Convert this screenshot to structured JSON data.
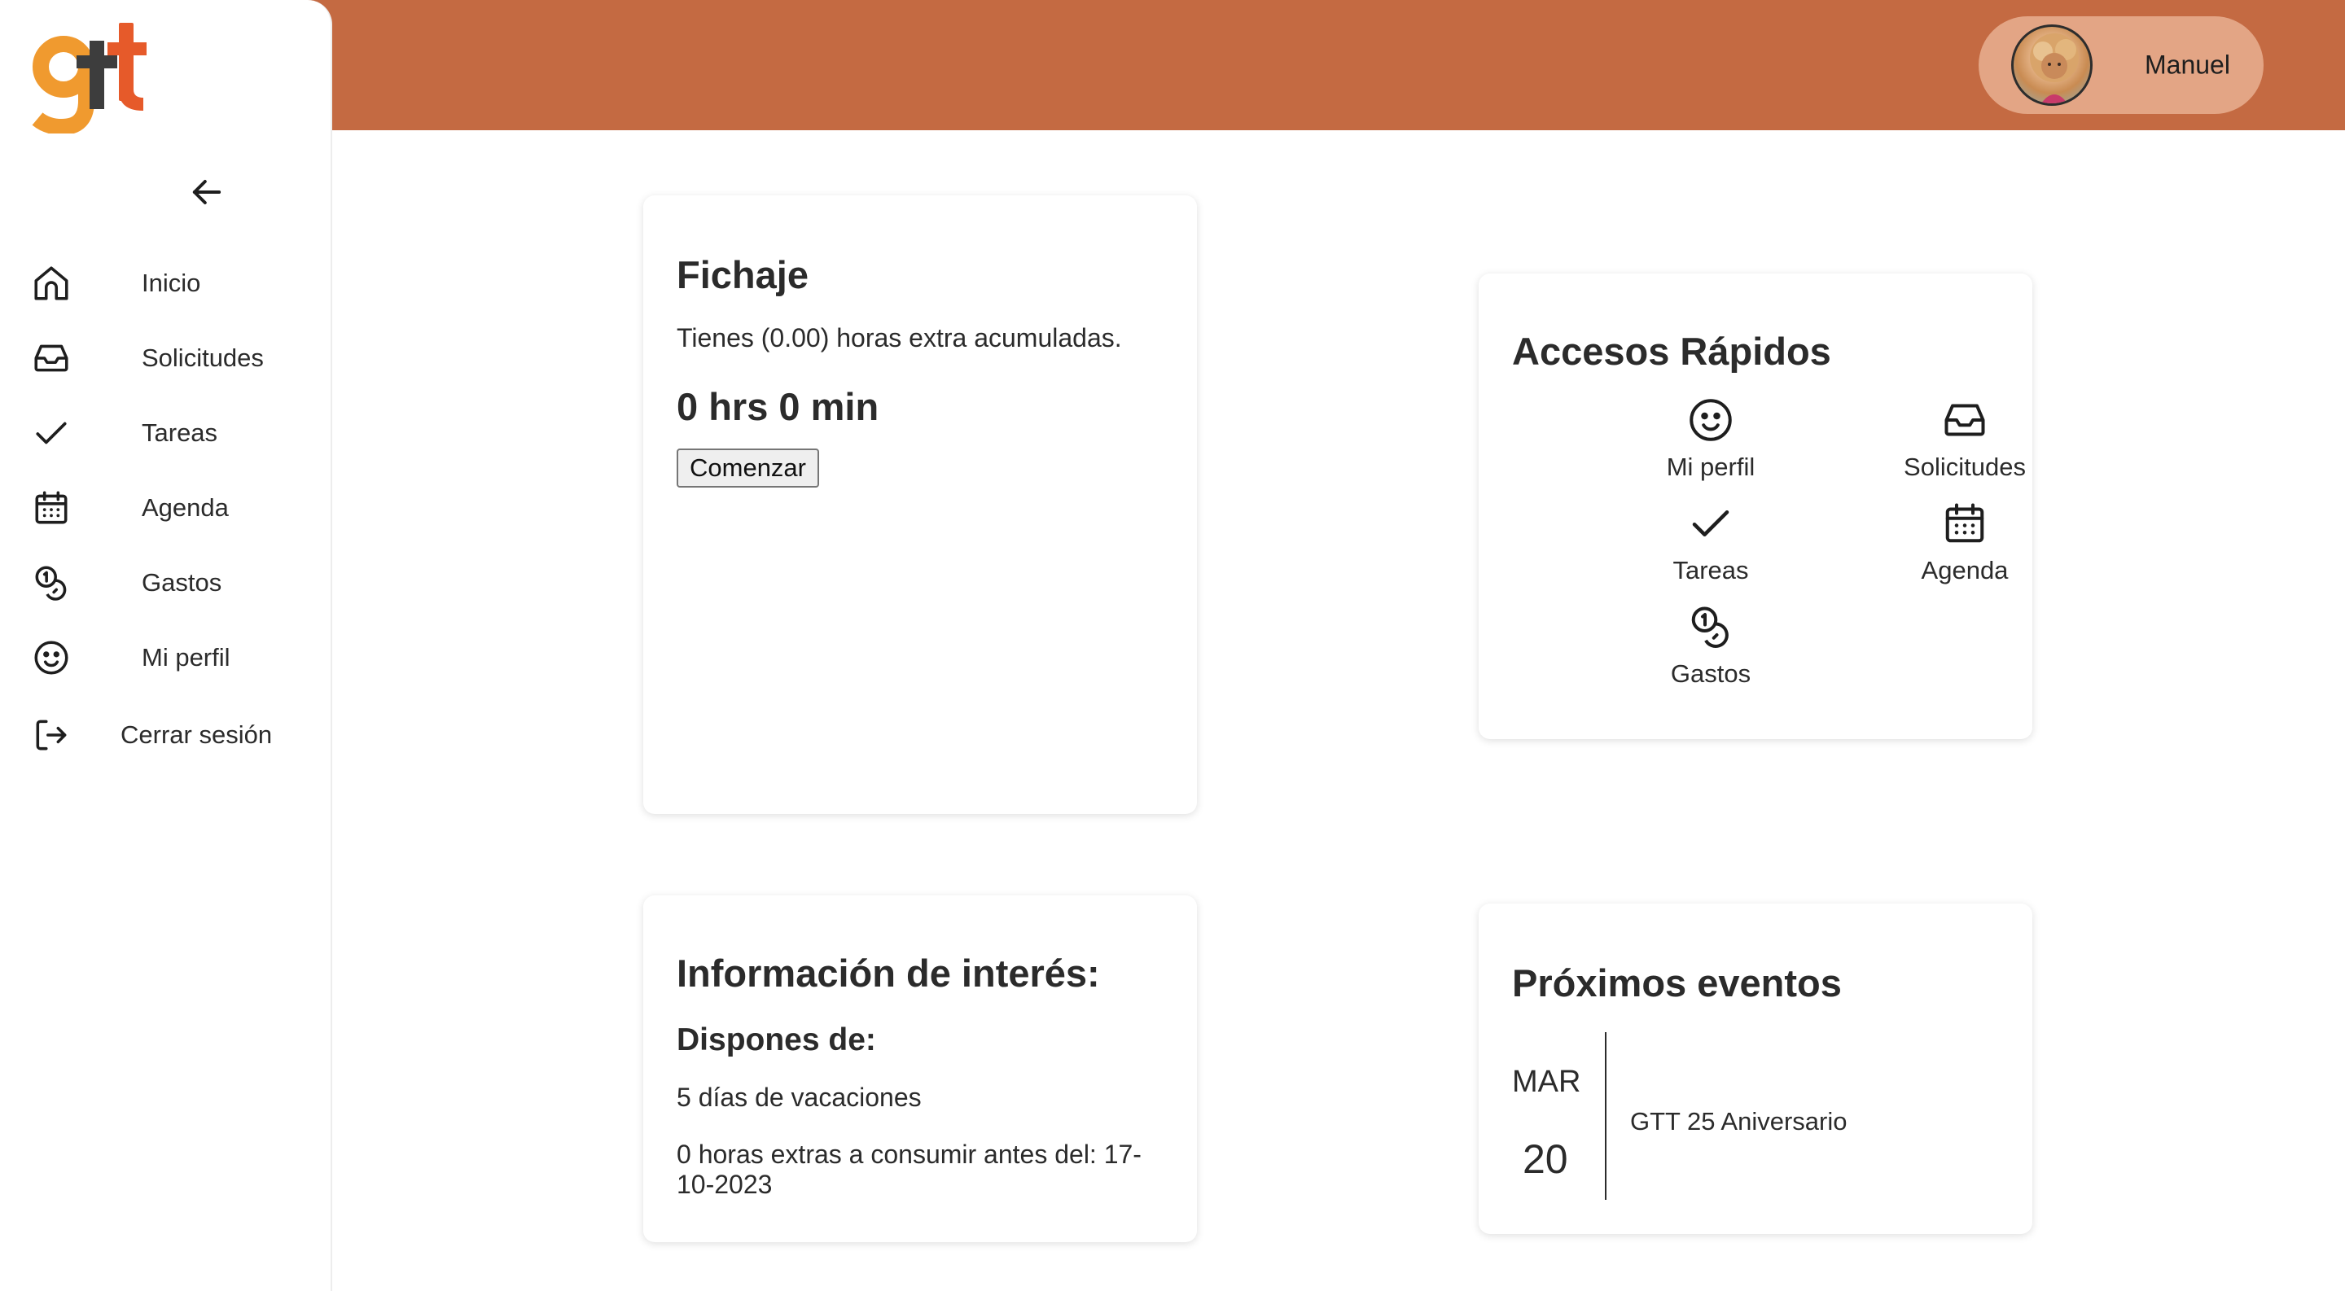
{
  "brand": {
    "logo_text": "gtt",
    "accent": "#c46a42",
    "pill": "#e3a585"
  },
  "header": {
    "user_name": "Manuel",
    "avatar_icon": "user-avatar"
  },
  "sidebar": {
    "collapse_icon": "arrow-left-icon",
    "items": [
      {
        "label": "Inicio",
        "icon": "home-icon"
      },
      {
        "label": "Solicitudes",
        "icon": "inbox-icon"
      },
      {
        "label": "Tareas",
        "icon": "check-icon"
      },
      {
        "label": "Agenda",
        "icon": "calendar-icon"
      },
      {
        "label": "Gastos",
        "icon": "coins-icon"
      },
      {
        "label": "Mi perfil",
        "icon": "smiley-icon"
      },
      {
        "label": "Cerrar sesión",
        "icon": "logout-icon"
      }
    ]
  },
  "fichaje": {
    "title": "Fichaje",
    "description": "Tienes (0.00) horas extra acumuladas.",
    "timer": "0 hrs 0 min",
    "start_label": "Comenzar"
  },
  "accesos": {
    "title": "Accesos Rápidos",
    "items": [
      {
        "label": "Mi perfil",
        "icon": "smiley-icon"
      },
      {
        "label": "Solicitudes",
        "icon": "inbox-icon"
      },
      {
        "label": "Tareas",
        "icon": "check-icon"
      },
      {
        "label": "Agenda",
        "icon": "calendar-icon"
      },
      {
        "label": "Gastos",
        "icon": "coins-icon"
      }
    ]
  },
  "info": {
    "title": "Información de interés:",
    "subtitle": "Dispones de:",
    "vacation": "5 días de vacaciones",
    "overtime": "0 horas extras a consumir antes del: 17-10-2023"
  },
  "eventos": {
    "title": "Próximos eventos",
    "items": [
      {
        "month": "MAR",
        "day": "20",
        "title": "GTT 25 Aniversario"
      }
    ]
  }
}
